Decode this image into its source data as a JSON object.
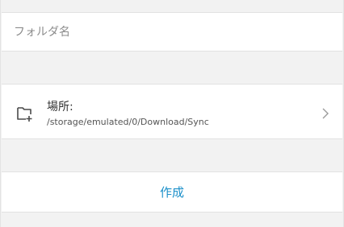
{
  "folder_name": {
    "value": "",
    "placeholder": "フォルダ名"
  },
  "location": {
    "label": "場所:",
    "path": "/storage/emulated/0/Download/Sync",
    "icon": "folder-add-icon",
    "chevron": "chevron-right-icon"
  },
  "actions": {
    "create_label": "作成",
    "accent_color": "#1a8fc9"
  }
}
